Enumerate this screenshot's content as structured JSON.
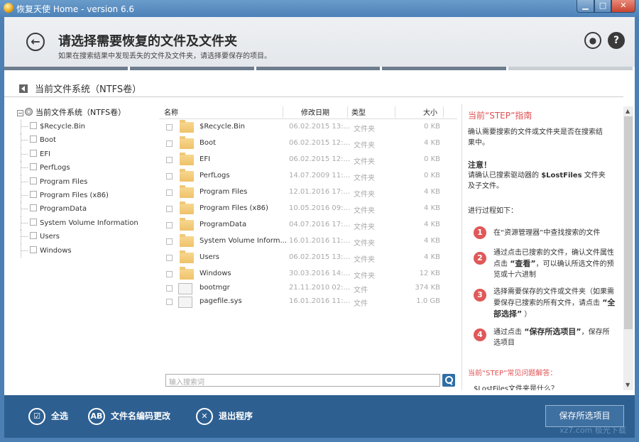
{
  "window": {
    "title": "恢复天使 Home - version 6.6",
    "controls": {
      "minimize": "▁",
      "maximize": "□",
      "close": "✕"
    }
  },
  "header": {
    "title": "请选择需要恢复的文件及文件夹",
    "subtitle": "如果在搜索结果中发现丢失的文件及文件夹，请选择要保存的项目。",
    "back_icon": "←",
    "user_icon": "●",
    "help_icon": "?"
  },
  "progress_steps": [
    {
      "state": "done"
    },
    {
      "state": "done"
    },
    {
      "state": "done"
    },
    {
      "state": "cur"
    },
    {
      "state": "todo"
    }
  ],
  "filesystem_bar": {
    "label": "当前文件系统（NTFS卷）"
  },
  "tree": {
    "root": "当前文件系统（NTFS卷）",
    "items": [
      "$Recycle.Bin",
      "Boot",
      "EFI",
      "PerfLogs",
      "Program Files",
      "Program Files (x86)",
      "ProgramData",
      "System Volume Information",
      "Users",
      "Windows"
    ]
  },
  "file_list": {
    "columns": {
      "name": "名称",
      "date": "修改日期",
      "type": "类型",
      "size": "大小"
    },
    "rows": [
      {
        "name": "$Recycle.Bin",
        "date": "06.02.2015 13:...",
        "type": "文件夹",
        "size": "0 KB",
        "kind": "folder"
      },
      {
        "name": "Boot",
        "date": "06.02.2015 12:...",
        "type": "文件夹",
        "size": "4 KB",
        "kind": "folder"
      },
      {
        "name": "EFI",
        "date": "06.02.2015 12:...",
        "type": "文件夹",
        "size": "0 KB",
        "kind": "folder"
      },
      {
        "name": "PerfLogs",
        "date": "14.07.2009 11:...",
        "type": "文件夹",
        "size": "0 KB",
        "kind": "folder"
      },
      {
        "name": "Program Files",
        "date": "12.01.2016 17:...",
        "type": "文件夹",
        "size": "4 KB",
        "kind": "folder"
      },
      {
        "name": "Program Files (x86)",
        "date": "10.05.2016 09:...",
        "type": "文件夹",
        "size": "4 KB",
        "kind": "folder"
      },
      {
        "name": "ProgramData",
        "date": "04.07.2016 17:...",
        "type": "文件夹",
        "size": "4 KB",
        "kind": "folder"
      },
      {
        "name": "System Volume Inform...",
        "date": "16.01.2016 11:...",
        "type": "文件夹",
        "size": "4 KB",
        "kind": "folder"
      },
      {
        "name": "Users",
        "date": "06.02.2015 13:...",
        "type": "文件夹",
        "size": "4 KB",
        "kind": "folder"
      },
      {
        "name": "Windows",
        "date": "30.03.2016 14:...",
        "type": "文件夹",
        "size": "12 KB",
        "kind": "folder"
      },
      {
        "name": "bootmgr",
        "date": "21.11.2010 02:...",
        "type": "文件",
        "size": "374 KB",
        "kind": "file"
      },
      {
        "name": "pagefile.sys",
        "date": "16.01.2016 11:...",
        "type": "文件",
        "size": "1.0 GB",
        "kind": "file"
      }
    ]
  },
  "search": {
    "placeholder": "输入搜索词"
  },
  "guide": {
    "title": "当前“STEP”指南",
    "intro": "确认需要搜索的文件或文件夹是否在搜索结果中。",
    "note_title": "注意！",
    "note_text_1": "请确认已搜索驱动器的",
    "note_bold": "$LostFiles",
    "note_text_2": "文件夹及子文件。",
    "process": "进行过程如下：",
    "steps": [
      {
        "num": "1",
        "text": "在“资源管理器”中查找搜索的文件"
      },
      {
        "num": "2",
        "text_1": "通过点击已搜索的文件，确认文件属性点击",
        "bold": "“查看”",
        "text_2": "，可以确认所选文件的预览或十六进制"
      },
      {
        "num": "3",
        "text_1": "选择需要保存的文件或文件夹（如果需要保存已搜索的所有文件，请点击",
        "bold": "“全部选择”",
        "text_2": "）"
      },
      {
        "num": "4",
        "text_1": "通过点击",
        "bold": "“保存所选项目”",
        "text_2": "，保存所选项目"
      }
    ],
    "faq": "当前“STEP”常见问题解答：",
    "faq_item": "$LostFiles文件夹是什么？"
  },
  "bottom": {
    "select_all": "全选",
    "select_all_icon": "☑",
    "encoding": "文件名编码更改",
    "encoding_icon": "AB",
    "exit": "退出程序",
    "exit_icon": "✕",
    "save": "保存所选项目"
  },
  "watermark": "xz7.com 极光下载"
}
